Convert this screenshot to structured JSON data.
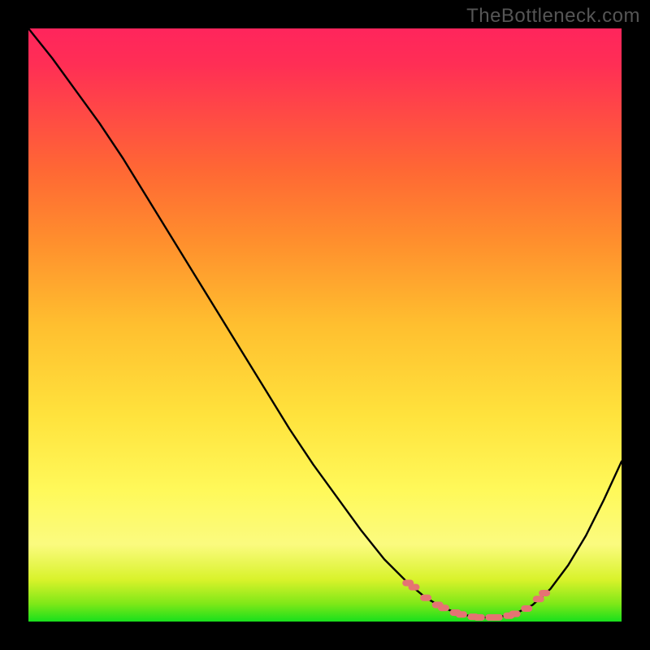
{
  "watermark": "TheBottleneck.com",
  "chart_data": {
    "type": "line",
    "title": "",
    "xlabel": "",
    "ylabel": "",
    "xlim": [
      0,
      100
    ],
    "ylim": [
      0,
      100
    ],
    "grid": false,
    "legend": false,
    "series": [
      {
        "name": "bottleneck-curve",
        "x": [
          0,
          4,
          8,
          12,
          16,
          20,
          24,
          28,
          32,
          36,
          40,
          44,
          48,
          52,
          56,
          60,
          64,
          67,
          70,
          73,
          76,
          79,
          82,
          85,
          88,
          91,
          94,
          97,
          100
        ],
        "y": [
          100,
          95,
          89.5,
          84,
          78,
          71.5,
          65,
          58.5,
          52,
          45.5,
          39,
          32.5,
          26.5,
          21,
          15.5,
          10.5,
          6.5,
          4,
          2.3,
          1.2,
          0.7,
          0.7,
          1.3,
          2.8,
          5.5,
          9.5,
          14.5,
          20.5,
          27
        ]
      }
    ],
    "markers": {
      "name": "optimal-range-markers",
      "color": "#e57373",
      "points": [
        {
          "x": 64,
          "y": 6.5
        },
        {
          "x": 65,
          "y": 5.8
        },
        {
          "x": 67,
          "y": 4.0
        },
        {
          "x": 69,
          "y": 2.8
        },
        {
          "x": 70,
          "y": 2.3
        },
        {
          "x": 72,
          "y": 1.5
        },
        {
          "x": 73,
          "y": 1.2
        },
        {
          "x": 75,
          "y": 0.8
        },
        {
          "x": 76,
          "y": 0.7
        },
        {
          "x": 78,
          "y": 0.7
        },
        {
          "x": 79,
          "y": 0.7
        },
        {
          "x": 81,
          "y": 1.0
        },
        {
          "x": 82,
          "y": 1.3
        },
        {
          "x": 84,
          "y": 2.2
        },
        {
          "x": 86,
          "y": 3.8
        },
        {
          "x": 87,
          "y": 4.8
        }
      ]
    },
    "gradient_colors": {
      "bottom": "#18e01c",
      "mid_low": "#fbfb7f",
      "mid": "#ffe23c",
      "mid_high": "#ff8f2d",
      "top": "#ff255c"
    }
  }
}
